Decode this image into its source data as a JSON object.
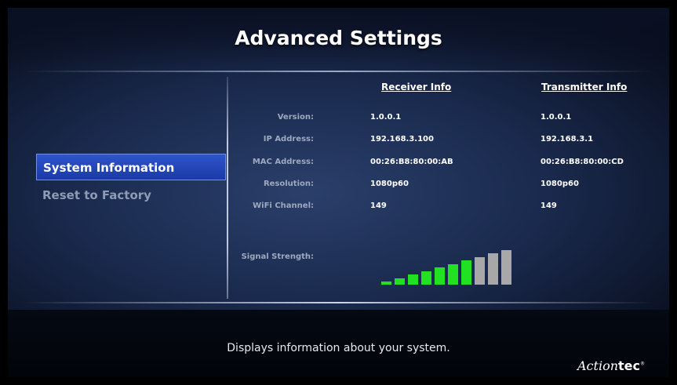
{
  "title": "Advanced Settings",
  "menu": [
    {
      "label": "System Information",
      "selected": true
    },
    {
      "label": "Reset to Factory",
      "selected": false
    }
  ],
  "columns": {
    "receiver": "Receiver Info",
    "transmitter": "Transmitter Info"
  },
  "rows": [
    {
      "label": "Version:",
      "receiver": "1.0.0.1",
      "transmitter": "1.0.0.1"
    },
    {
      "label": "IP Address:",
      "receiver": "192.168.3.100",
      "transmitter": "192.168.3.1"
    },
    {
      "label": "MAC Address:",
      "receiver": "00:26:B8:80:00:AB",
      "transmitter": "00:26:B8:80:00:CD"
    },
    {
      "label": "Resolution:",
      "receiver": "1080p60",
      "transmitter": "1080p60"
    },
    {
      "label": "WiFi Channel:",
      "receiver": "149",
      "transmitter": "149"
    }
  ],
  "signal": {
    "label": "Signal Strength:",
    "level": 7,
    "total": 10,
    "active_color": "#22e022",
    "inactive_color": "#a8a8a8"
  },
  "footer": {
    "description": "Displays information about your system.",
    "brand_italic": "Action",
    "brand_bold": "tec",
    "brand_mark": "®"
  }
}
